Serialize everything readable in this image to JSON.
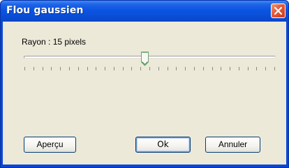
{
  "window": {
    "title": "Flou gaussien"
  },
  "icons": {
    "close": "close-x-icon",
    "slider_thumb": "slider-thumb-pointer"
  },
  "radius": {
    "label": "Rayon : 15 pixels",
    "value": 15,
    "slider_fraction": 0.48,
    "tick_count": 29
  },
  "buttons": {
    "preview": "Aperçu",
    "ok": "Ok",
    "cancel": "Annuler"
  },
  "colors": {
    "titlebar": "#0a55e2",
    "close_button": "#e2593a",
    "client_background": "#ece9d8",
    "button_border": "#003c74"
  }
}
